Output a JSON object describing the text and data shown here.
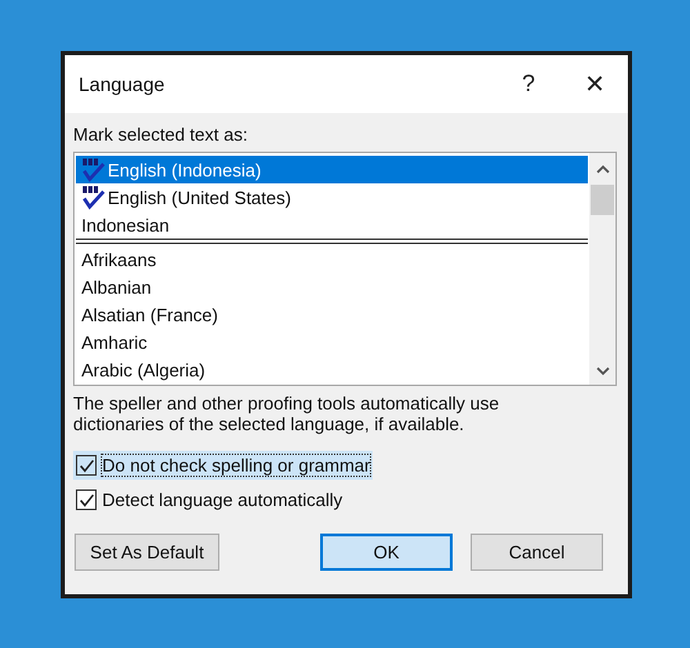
{
  "window": {
    "title": "Language",
    "help": "?",
    "close": "✕"
  },
  "list_label": "Mark selected text as:",
  "recent_languages": [
    {
      "label": "English (Indonesia)",
      "selected": true,
      "proofing": true
    },
    {
      "label": "English (United States)",
      "selected": false,
      "proofing": true
    },
    {
      "label": "Indonesian",
      "selected": false,
      "proofing": false
    }
  ],
  "all_languages": [
    {
      "label": "Afrikaans",
      "selected": false
    },
    {
      "label": "Albanian",
      "selected": false
    },
    {
      "label": "Alsatian (France)",
      "selected": false
    },
    {
      "label": "Amharic",
      "selected": false
    },
    {
      "label": "Arabic (Algeria)",
      "selected": false
    }
  ],
  "description": "The speller and other proofing tools automatically use dictionaries of the selected language, if available.",
  "checkboxes": [
    {
      "label": "Do not check spelling or grammar",
      "checked": true,
      "focused": true
    },
    {
      "label": "Detect language automatically",
      "checked": true,
      "focused": false
    }
  ],
  "buttons": [
    {
      "label": "Set As Default",
      "default": false
    },
    {
      "label": "OK",
      "default": true
    },
    {
      "label": "Cancel",
      "default": false
    }
  ]
}
